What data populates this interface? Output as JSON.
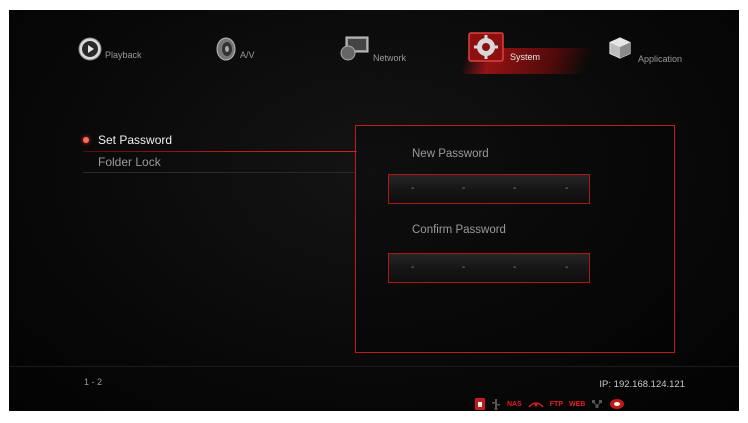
{
  "menu": {
    "items": [
      {
        "label": "Playback",
        "icon": "play-icon"
      },
      {
        "label": "A/V",
        "icon": "av-icon"
      },
      {
        "label": "Network",
        "icon": "network-icon"
      },
      {
        "label": "System",
        "icon": "system-icon",
        "active": true
      },
      {
        "label": "Application",
        "icon": "application-icon"
      }
    ]
  },
  "sidebar": {
    "items": [
      {
        "label": "Set Password",
        "active": true
      },
      {
        "label": "Folder Lock"
      }
    ]
  },
  "password_panel": {
    "new_label": "New Password",
    "new_value": [
      "-",
      "-",
      "-",
      "-"
    ],
    "confirm_label": "Confirm Password",
    "confirm_value": [
      "-",
      "-",
      "-",
      "-"
    ]
  },
  "footer": {
    "page": "1 - 2",
    "ip": "IP: 192.168.124.121",
    "status_icons": [
      "NAS",
      "FTP",
      "WEB"
    ]
  },
  "colors": {
    "accent": "#c01a1a",
    "bullet": "#ff6a5a"
  }
}
